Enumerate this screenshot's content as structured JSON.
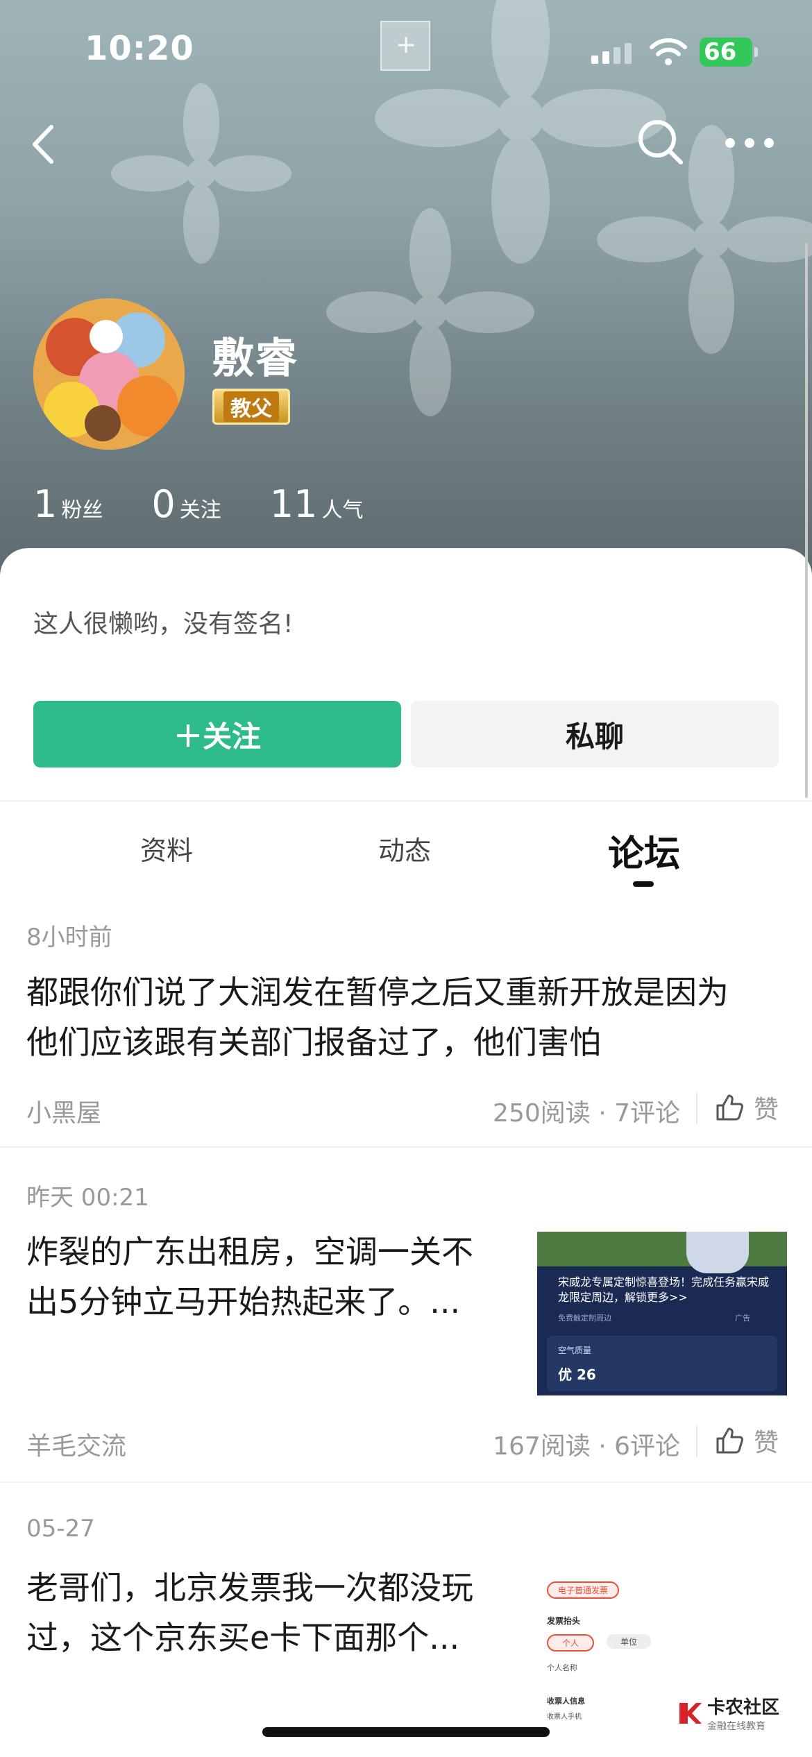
{
  "status_bar": {
    "time": "10:20",
    "battery": "66"
  },
  "profile": {
    "name": "敷睿",
    "badge": "教父",
    "stats": [
      {
        "value": "1",
        "label": "粉丝"
      },
      {
        "value": "0",
        "label": "关注"
      },
      {
        "value": "11",
        "label": "人气"
      }
    ],
    "signature": "这人很懒哟，没有签名!"
  },
  "actions": {
    "follow": "＋关注",
    "chat": "私聊"
  },
  "tabs": [
    {
      "label": "资料",
      "active": false
    },
    {
      "label": "动态",
      "active": false
    },
    {
      "label": "论坛",
      "active": true
    }
  ],
  "posts": [
    {
      "time": "8小时前",
      "title_lines": [
        "都跟你们说了大润发在暂停之后又重新开放是因为",
        "他们应该跟有关部门报备过了，他们害怕"
      ],
      "forum": "小黑屋",
      "stats": "250阅读 · 7评论",
      "like": "赞"
    },
    {
      "time": "昨天 00:21",
      "title_lines": [
        "炸裂的广东出租房，空调一关不",
        "出5分钟立马开始热起来了。..."
      ],
      "forum": "羊毛交流",
      "stats": "167阅读 · 6评论",
      "like": "赞",
      "thumbnail": {
        "promo": "宋威龙专属定制惊喜登场！完成任务赢宋威龙限定周边，解锁更多>>",
        "small": "免费触定制周边",
        "ad": "广告",
        "air_label": "空气质量",
        "air_value": "优 26"
      }
    },
    {
      "time": "05-27",
      "title_lines": [
        "老哥们，北京发票我一次都没玩",
        "过，这个京东买e卡下面那个..."
      ],
      "thumbnail": {
        "invoice_type": "电子普通发票",
        "header_label": "发票抬头",
        "personal": "个人",
        "company": "单位",
        "name_label": "个人名称",
        "receiver": "收票人信息",
        "phone": "收票人手机"
      }
    }
  ],
  "watermark": {
    "name": "卡农社区",
    "sub": "金融在线教育"
  },
  "colors": {
    "accent": "#2dbb8c",
    "badge_gold": "#c9951f"
  }
}
